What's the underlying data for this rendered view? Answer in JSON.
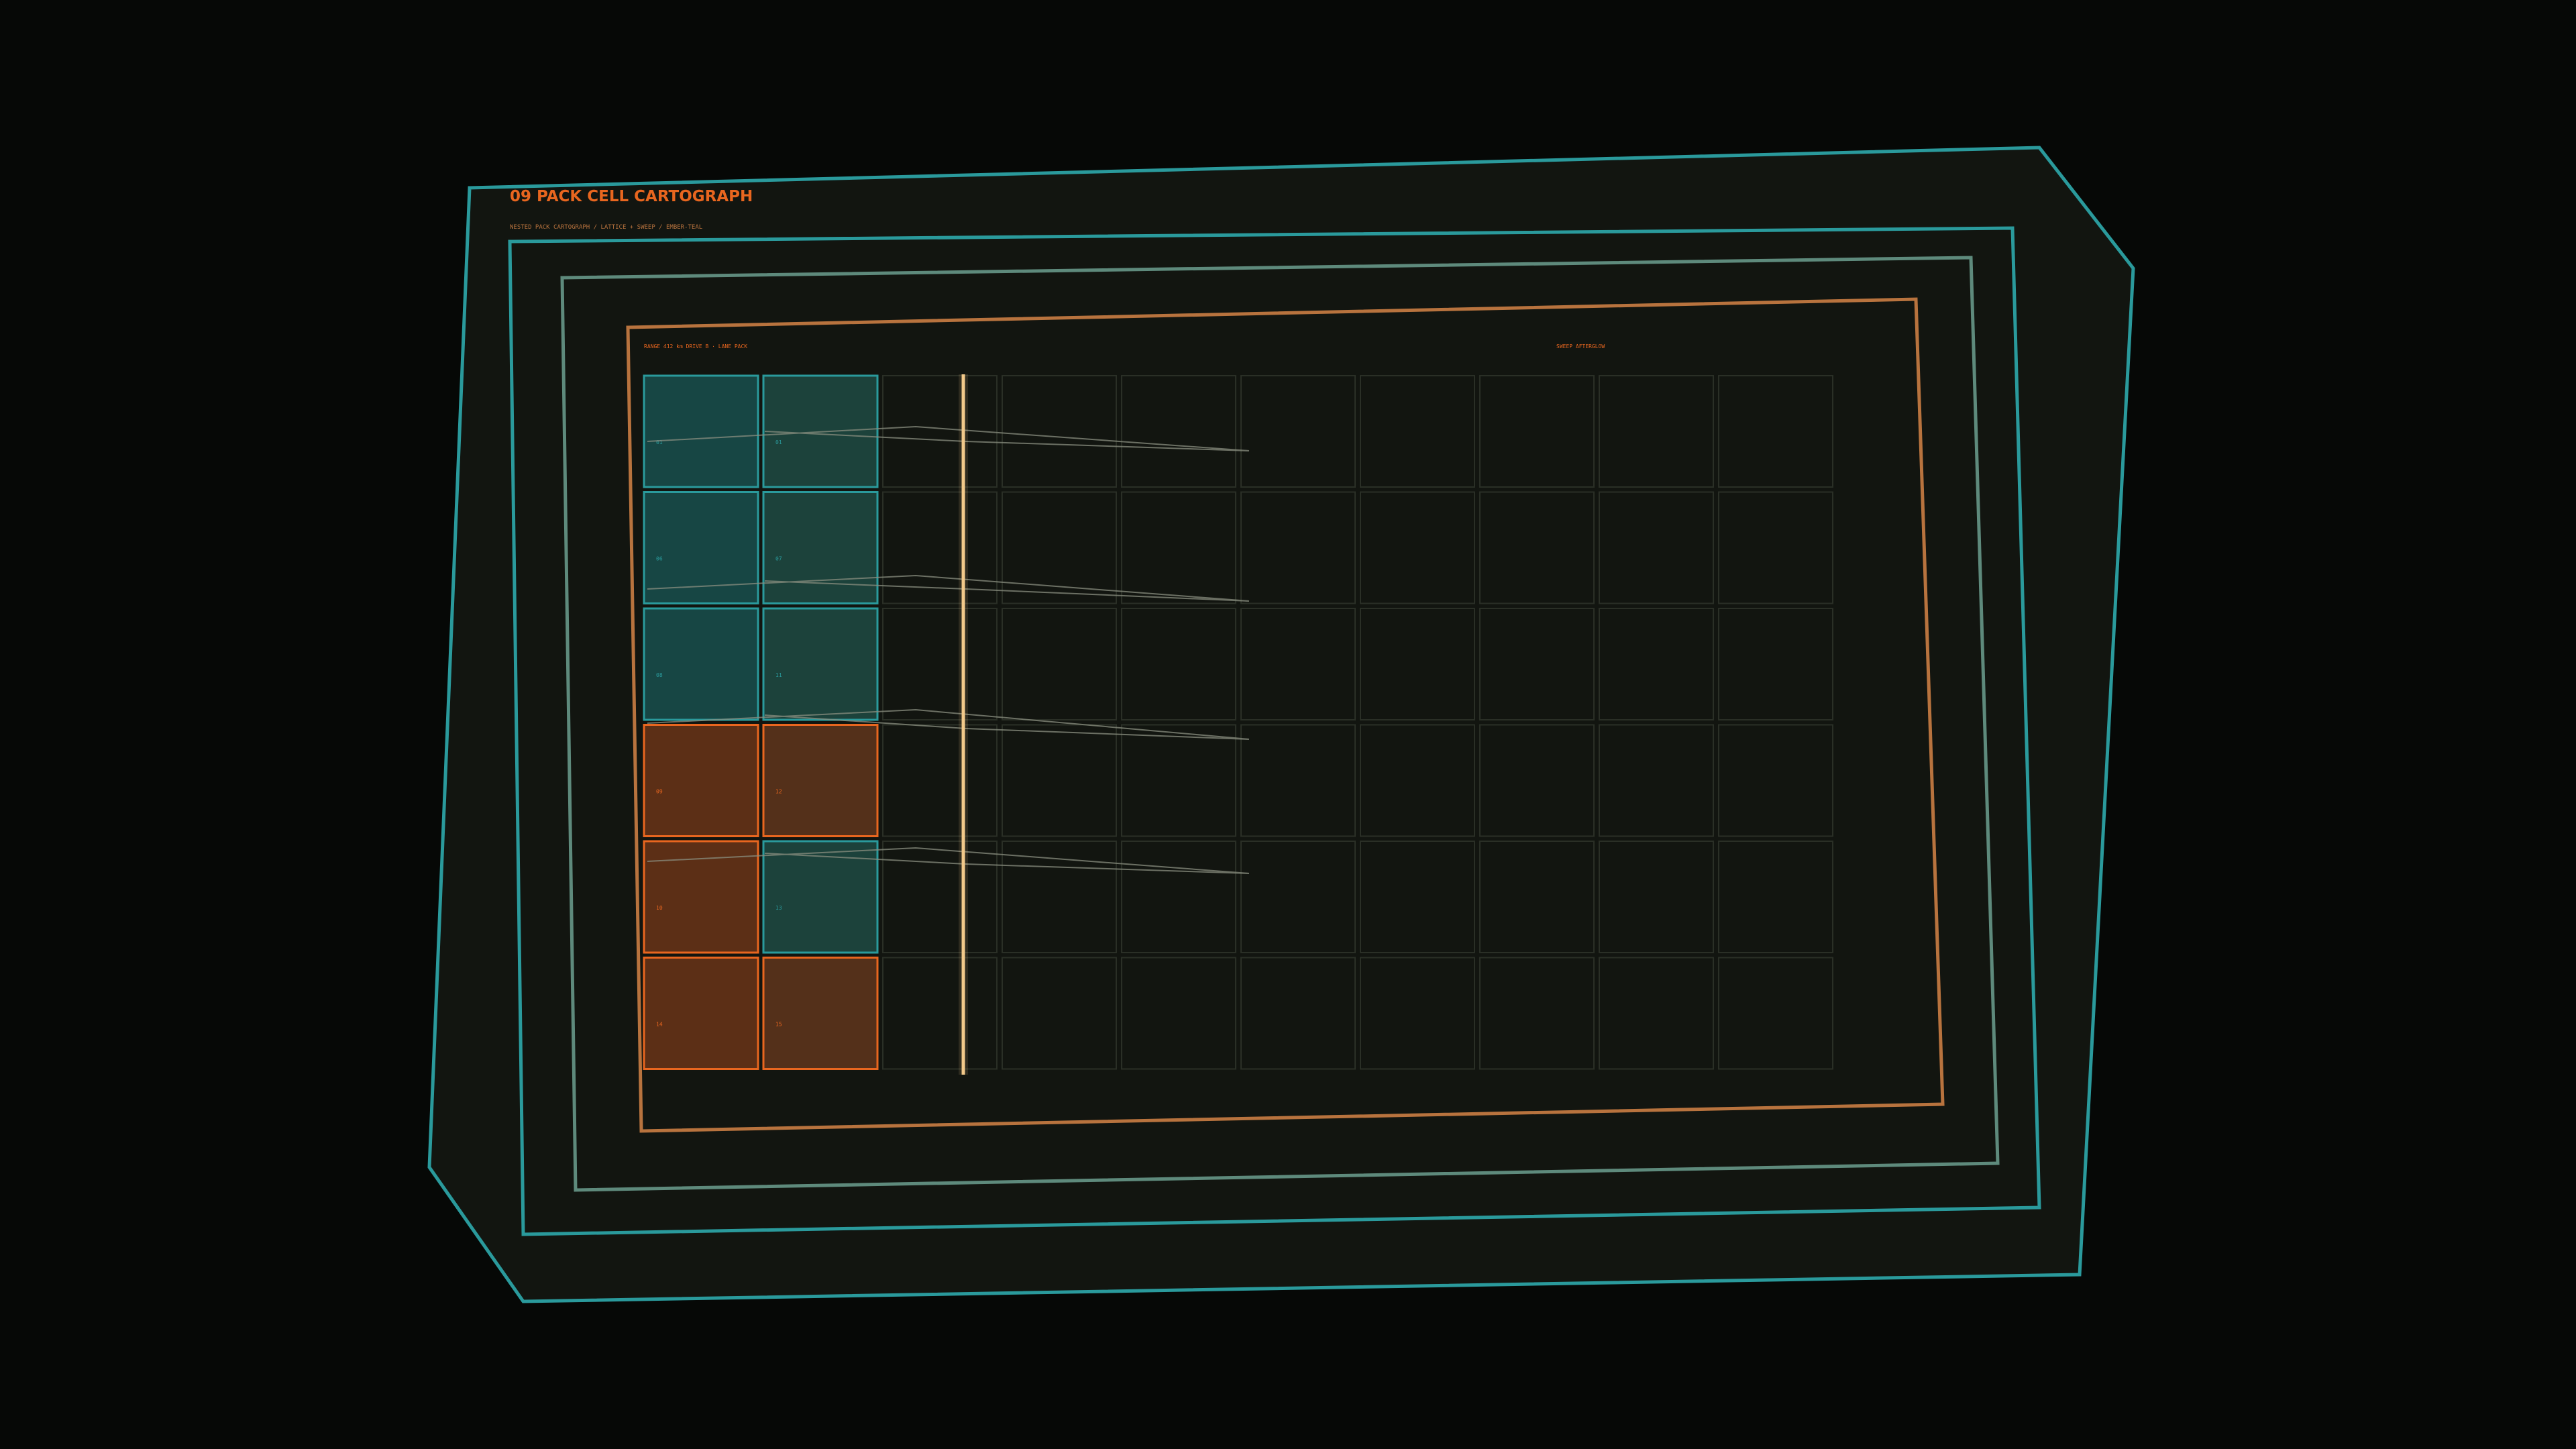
{
  "header": {
    "index": "09",
    "title": "PACK CELL CARTOGRAPH",
    "subtitle": "NESTED PACK CARTOGRAPH / LATTICE + SWEEP / EMBER-TEAL"
  },
  "panel": {
    "left_label": "RANGE 412 km  DRIVE B · LANE PACK",
    "right_label": "SWEEP AFTERGLOW"
  },
  "colors": {
    "background": "#060806",
    "panel_fill": "#121510",
    "teal": "#2a9a9c",
    "teal_muted": "#5e8a7c",
    "ember": "#e8661f",
    "copper": "#b8733e",
    "sweep": "#f2c98a",
    "cell_teal_fill": "#174644",
    "cell_teal_fill_2": "#1c423b",
    "cell_ember_fill": "#5c2f16",
    "cell_ember_fill_2": "#54301a",
    "empty_stroke": "#2a2f26"
  },
  "grid": {
    "rows": 6,
    "columns": 10,
    "cells": [
      [
        {
          "state": "teal",
          "label": "01"
        },
        {
          "state": "teal",
          "label": "01"
        },
        {
          "state": "empty",
          "label": ""
        },
        {
          "state": "empty",
          "label": ""
        },
        {
          "state": "empty",
          "label": ""
        },
        {
          "state": "empty",
          "label": ""
        },
        {
          "state": "empty",
          "label": ""
        },
        {
          "state": "empty",
          "label": ""
        },
        {
          "state": "empty",
          "label": ""
        },
        {
          "state": "empty",
          "label": ""
        }
      ],
      [
        {
          "state": "teal",
          "label": "06"
        },
        {
          "state": "teal",
          "label": "07"
        },
        {
          "state": "empty",
          "label": ""
        },
        {
          "state": "empty",
          "label": ""
        },
        {
          "state": "empty",
          "label": ""
        },
        {
          "state": "empty",
          "label": ""
        },
        {
          "state": "empty",
          "label": ""
        },
        {
          "state": "empty",
          "label": ""
        },
        {
          "state": "empty",
          "label": ""
        },
        {
          "state": "empty",
          "label": ""
        }
      ],
      [
        {
          "state": "teal",
          "label": "08"
        },
        {
          "state": "teal",
          "label": "11"
        },
        {
          "state": "empty",
          "label": ""
        },
        {
          "state": "empty",
          "label": ""
        },
        {
          "state": "empty",
          "label": ""
        },
        {
          "state": "empty",
          "label": ""
        },
        {
          "state": "empty",
          "label": ""
        },
        {
          "state": "empty",
          "label": ""
        },
        {
          "state": "empty",
          "label": ""
        },
        {
          "state": "empty",
          "label": ""
        }
      ],
      [
        {
          "state": "ember",
          "label": "09"
        },
        {
          "state": "ember",
          "label": "12"
        },
        {
          "state": "empty",
          "label": ""
        },
        {
          "state": "empty",
          "label": ""
        },
        {
          "state": "empty",
          "label": ""
        },
        {
          "state": "empty",
          "label": ""
        },
        {
          "state": "empty",
          "label": ""
        },
        {
          "state": "empty",
          "label": ""
        },
        {
          "state": "empty",
          "label": ""
        },
        {
          "state": "empty",
          "label": ""
        }
      ],
      [
        {
          "state": "ember",
          "label": "10"
        },
        {
          "state": "teal",
          "label": "13"
        },
        {
          "state": "empty",
          "label": ""
        },
        {
          "state": "empty",
          "label": ""
        },
        {
          "state": "empty",
          "label": ""
        },
        {
          "state": "empty",
          "label": ""
        },
        {
          "state": "empty",
          "label": ""
        },
        {
          "state": "empty",
          "label": ""
        },
        {
          "state": "empty",
          "label": ""
        },
        {
          "state": "empty",
          "label": ""
        }
      ],
      [
        {
          "state": "ember",
          "label": "14"
        },
        {
          "state": "ember",
          "label": "15"
        },
        {
          "state": "empty",
          "label": ""
        },
        {
          "state": "empty",
          "label": ""
        },
        {
          "state": "empty",
          "label": ""
        },
        {
          "state": "empty",
          "label": ""
        },
        {
          "state": "empty",
          "label": ""
        },
        {
          "state": "empty",
          "label": ""
        },
        {
          "state": "empty",
          "label": ""
        },
        {
          "state": "empty",
          "label": ""
        }
      ]
    ]
  }
}
